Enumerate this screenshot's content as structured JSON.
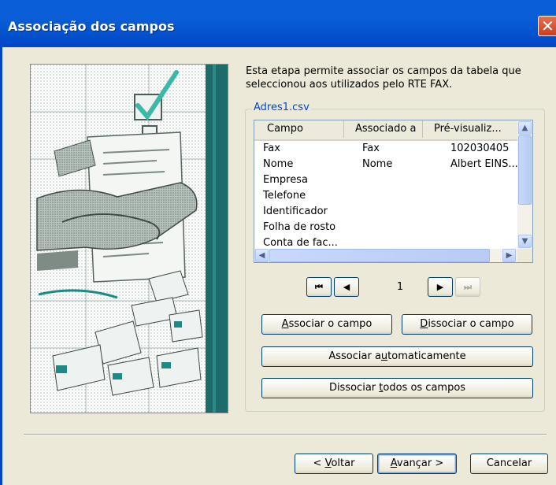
{
  "window": {
    "title": "Associação dos campos",
    "close_glyph": "✕"
  },
  "intro_text": "Esta etapa permite associar os campos da tabela que seleccionou aos utilizados pelo RTE FAX.",
  "group_label": "Adres1.csv",
  "table": {
    "headers": [
      "Campo",
      "Associado a",
      "Pré-visualiz..."
    ],
    "rows": [
      [
        "Fax",
        "Fax",
        "102030405"
      ],
      [
        "Nome",
        "Nome",
        "Albert EINS..."
      ],
      [
        "Empresa",
        "",
        ""
      ],
      [
        "Telefone",
        "",
        ""
      ],
      [
        "Identificador",
        "",
        ""
      ],
      [
        "Folha de rosto",
        "",
        ""
      ],
      [
        "Conta de fac...",
        "",
        ""
      ]
    ]
  },
  "navigation": {
    "first": "⏮",
    "prev": "◀",
    "page": "1",
    "next": "▶",
    "last": "⏭"
  },
  "buttons": {
    "associate": {
      "pre": "",
      "key": "A",
      "post": "ssociar o campo"
    },
    "dissociate": {
      "pre": "",
      "key": "D",
      "post": "issociar o campo"
    },
    "auto": {
      "pre": "Associar a",
      "key": "u",
      "post": "tomaticamente"
    },
    "dissociate_all": {
      "pre": "Dissociar ",
      "key": "t",
      "post": "odos os campos"
    }
  },
  "footer": {
    "back": {
      "pre": "< ",
      "key": "V",
      "post": "oltar"
    },
    "next": {
      "pre": "",
      "key": "A",
      "post": "vançar >"
    },
    "cancel": "Cancelar"
  },
  "illustration": {
    "description_icon": "handshake-checkmark-illustration-icon",
    "colors": {
      "accent": "#1d6b6b",
      "check": "#3bb8a8"
    }
  }
}
